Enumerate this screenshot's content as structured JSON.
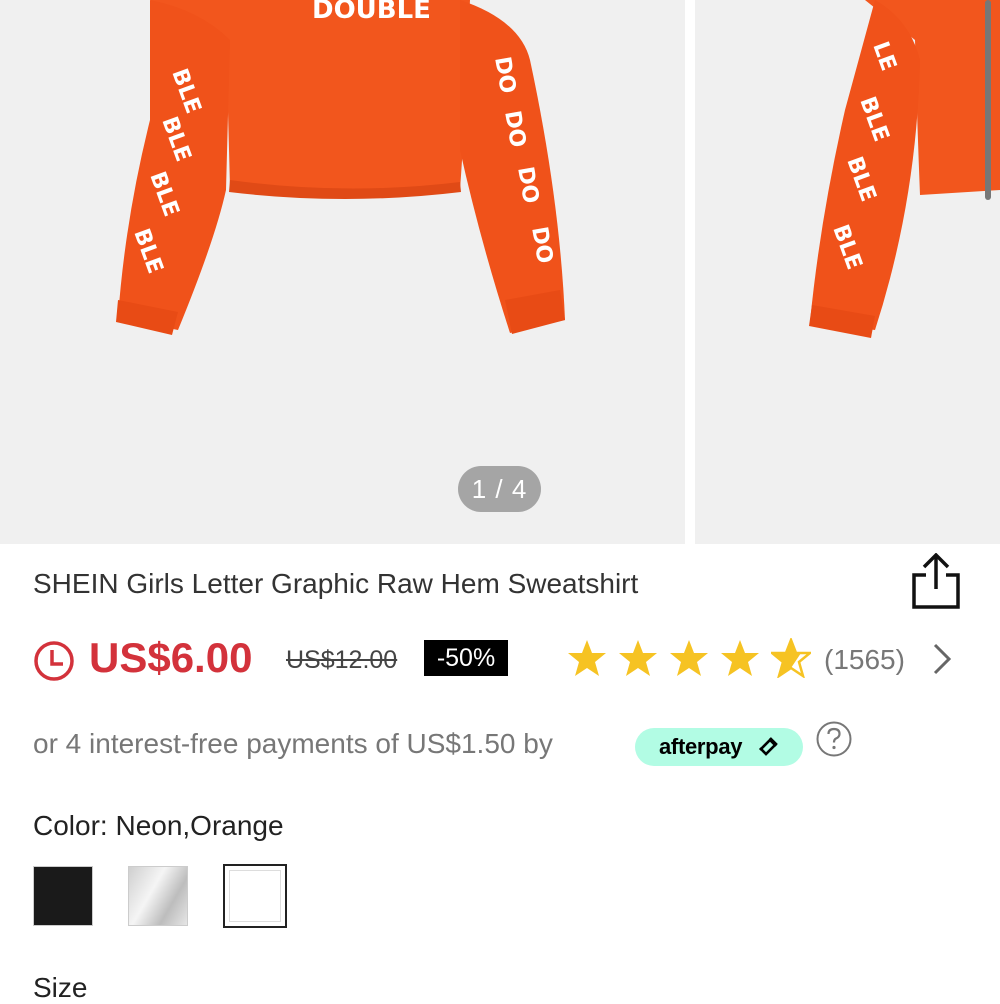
{
  "gallery": {
    "counter": "1 / 4",
    "print_word": "DOUBLE"
  },
  "product": {
    "title": "SHEIN Girls Letter Graphic Raw Hem Sweatshirt",
    "price": "US$6.00",
    "original_price": "US$12.00",
    "discount": "-50%",
    "rating": 4.5,
    "review_count": "(1565)"
  },
  "afterpay": {
    "text": "or 4 interest-free payments of US$1.50 by",
    "brand": "afterpay"
  },
  "color": {
    "label": "Color: Neon,Orange",
    "swatches": [
      "black",
      "silver",
      "white"
    ]
  },
  "size": {
    "label": "Size"
  },
  "colors": {
    "price_red": "#d3323b",
    "star_gold": "#f6c323",
    "afterpay_mint": "#b2fce4",
    "sweatshirt_orange": "#f2561d"
  }
}
